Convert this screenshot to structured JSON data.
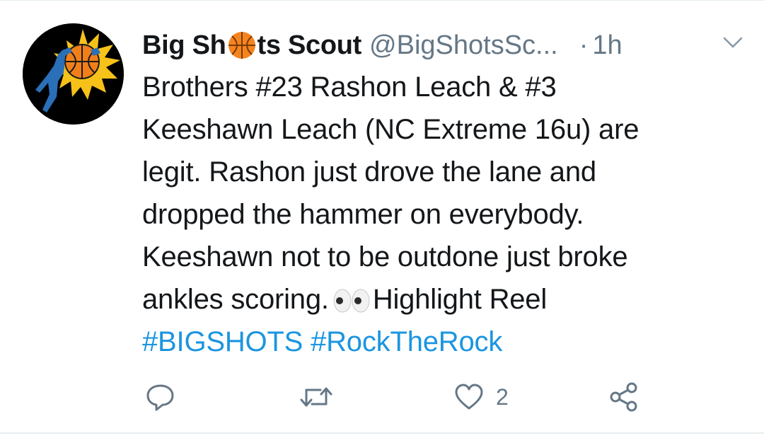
{
  "tweet": {
    "display_name_part1": "Big Sh",
    "display_name_part2": "ts Scout",
    "name_emoji": "basketball-icon",
    "handle": "@BigShotsSc...",
    "separator": "·",
    "time": "1h",
    "body_lines": [
      "Brothers #23 Rashon Leach & #3",
      "Keeshawn Leach (NC Extreme 16u) are",
      "legit. Rashon just drove the lane and",
      "dropped the hammer on everybody.",
      "Keeshawn not to be outdone just broke"
    ],
    "body_line6_before": "ankles scoring.",
    "body_line6_emoji": "eyes-icon",
    "body_line6_after": "Highlight Reel",
    "hashtags": [
      "#BIGSHOTS",
      "#RockTheRock"
    ],
    "like_count": "2"
  },
  "colors": {
    "text": "#14171a",
    "secondary": "#657786",
    "link": "#1b95e0",
    "divider": "#e6ecf0"
  }
}
